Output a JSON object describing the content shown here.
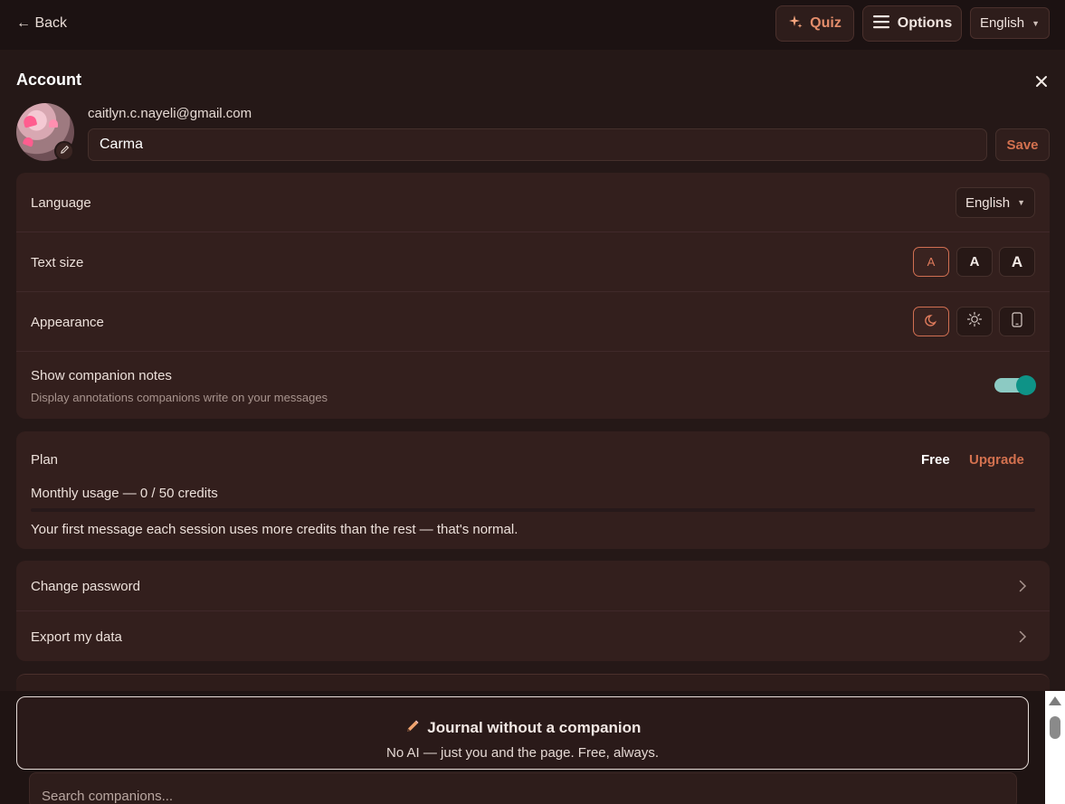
{
  "header": {
    "back_label": "← Back",
    "quiz_label": "Quiz",
    "options_label": "Options",
    "language": "English"
  },
  "account": {
    "title": "Account",
    "email": "caitlyn.c.nayeli@gmail.com",
    "display_name": "Carma",
    "save_label": "Save"
  },
  "settings": {
    "language_label": "Language",
    "language_value": "English",
    "text_size_label": "Text size",
    "text_sizes": [
      "A",
      "A",
      "A"
    ],
    "appearance_label": "Appearance",
    "companion_notes_label": "Show companion notes",
    "companion_notes_desc": "Display annotations companions write on your messages",
    "companion_notes_enabled": true
  },
  "plan": {
    "label": "Plan",
    "tier": "Free",
    "upgrade_label": "Upgrade",
    "usage_text": "Monthly usage — 0 / 50 credits",
    "usage_fraction": 0,
    "note": "Your first message each session uses more credits than the rest — that's normal."
  },
  "security": {
    "change_password_label": "Change password",
    "export_data_label": "Export my data"
  },
  "journal": {
    "title": "Journal without a companion",
    "subtitle": "No AI — just you and the page. Free, always."
  },
  "search": {
    "placeholder": "Search companions..."
  },
  "colors": {
    "accent": "#d3714f",
    "toggle_on": "#0e9387",
    "background": "#251817"
  }
}
